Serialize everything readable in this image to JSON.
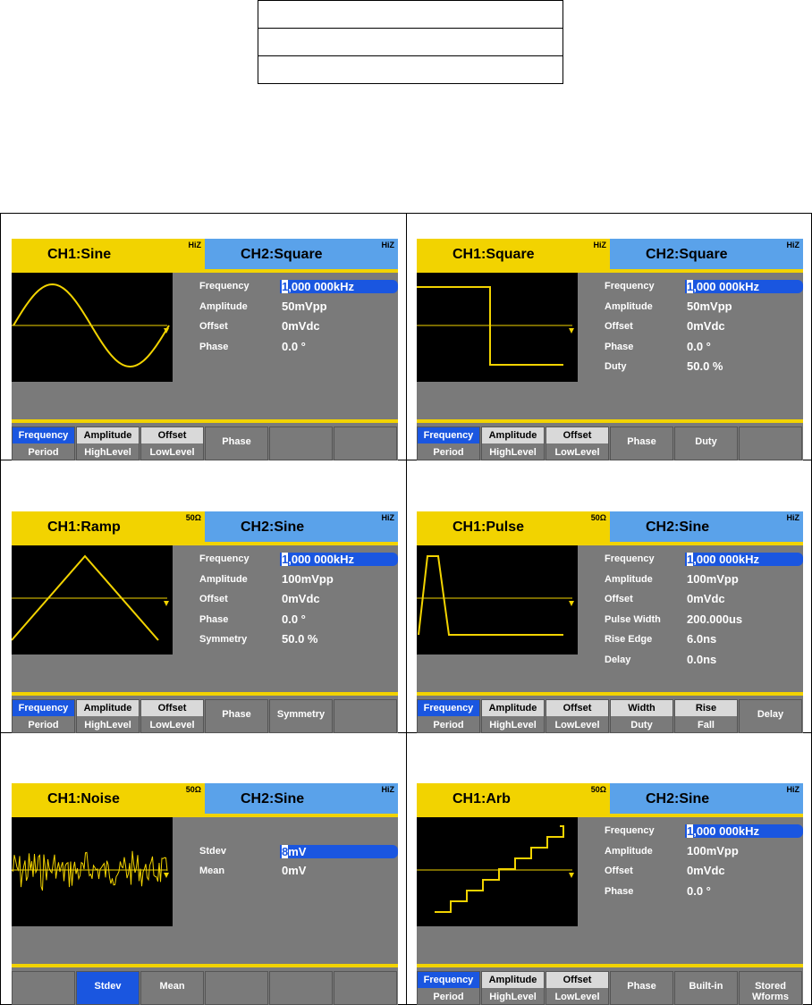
{
  "panels": [
    {
      "ch1": {
        "name": "CH1:Sine",
        "imp": "HiZ"
      },
      "ch2": {
        "name": "CH2:Square",
        "imp": "HiZ"
      },
      "wave": "sine",
      "params": [
        {
          "label": "Frequency",
          "value": "1,000 000kHz",
          "selected": true
        },
        {
          "label": "Amplitude",
          "value": "50mVpp"
        },
        {
          "label": "Offset",
          "value": "0mVdc"
        },
        {
          "label": "Phase",
          "value": "0.0 °"
        }
      ],
      "keys": [
        {
          "top": "Frequency",
          "bottom": "Period",
          "top_active": true
        },
        {
          "top": "Amplitude",
          "bottom": "HighLevel"
        },
        {
          "top": "Offset",
          "bottom": "LowLevel"
        },
        {
          "single": "Phase"
        },
        {
          "single": ""
        },
        {
          "single": ""
        }
      ]
    },
    {
      "ch1": {
        "name": "CH1:Square",
        "imp": "HiZ"
      },
      "ch2": {
        "name": "CH2:Square",
        "imp": "HiZ"
      },
      "wave": "square",
      "params": [
        {
          "label": "Frequency",
          "value": "1,000 000kHz",
          "selected": true
        },
        {
          "label": "Amplitude",
          "value": "50mVpp"
        },
        {
          "label": "Offset",
          "value": "0mVdc"
        },
        {
          "label": "Phase",
          "value": "0.0 °"
        },
        {
          "label": "Duty",
          "value": "50.0 %"
        }
      ],
      "keys": [
        {
          "top": "Frequency",
          "bottom": "Period",
          "top_active": true
        },
        {
          "top": "Amplitude",
          "bottom": "HighLevel"
        },
        {
          "top": "Offset",
          "bottom": "LowLevel"
        },
        {
          "single": "Phase"
        },
        {
          "single": "Duty"
        },
        {
          "single": ""
        }
      ]
    },
    {
      "ch1": {
        "name": "CH1:Ramp",
        "imp": "50Ω"
      },
      "ch2": {
        "name": "CH2:Sine",
        "imp": "HiZ"
      },
      "wave": "ramp",
      "params": [
        {
          "label": "Frequency",
          "value": "1,000 000kHz",
          "selected": true
        },
        {
          "label": "Amplitude",
          "value": "100mVpp"
        },
        {
          "label": "Offset",
          "value": "0mVdc"
        },
        {
          "label": "Phase",
          "value": "0.0 °"
        },
        {
          "label": "Symmetry",
          "value": "50.0 %"
        }
      ],
      "keys": [
        {
          "top": "Frequency",
          "bottom": "Period",
          "top_active": true
        },
        {
          "top": "Amplitude",
          "bottom": "HighLevel"
        },
        {
          "top": "Offset",
          "bottom": "LowLevel"
        },
        {
          "single": "Phase"
        },
        {
          "single": "Symmetry"
        },
        {
          "single": ""
        }
      ]
    },
    {
      "ch1": {
        "name": "CH1:Pulse",
        "imp": "50Ω"
      },
      "ch2": {
        "name": "CH2:Sine",
        "imp": "HiZ"
      },
      "wave": "pulse",
      "params": [
        {
          "label": "Frequency",
          "value": "1,000 000kHz",
          "selected": true
        },
        {
          "label": "Amplitude",
          "value": "100mVpp"
        },
        {
          "label": "Offset",
          "value": "0mVdc"
        },
        {
          "label": "Pulse Width",
          "value": "200.000us"
        },
        {
          "label": "Rise Edge",
          "value": "6.0ns"
        },
        {
          "label": "Delay",
          "value": "0.0ns"
        }
      ],
      "keys": [
        {
          "top": "Frequency",
          "bottom": "Period",
          "top_active": true
        },
        {
          "top": "Amplitude",
          "bottom": "HighLevel"
        },
        {
          "top": "Offset",
          "bottom": "LowLevel"
        },
        {
          "top": "Width",
          "bottom": "Duty"
        },
        {
          "top": "Rise",
          "bottom": "Fall"
        },
        {
          "single": "Delay"
        }
      ]
    },
    {
      "ch1": {
        "name": "CH1:Noise",
        "imp": "50Ω"
      },
      "ch2": {
        "name": "CH2:Sine",
        "imp": "HiZ"
      },
      "wave": "noise",
      "params": [
        {
          "label": "",
          "value": ""
        },
        {
          "label": "Stdev",
          "value": "8mV",
          "selected": true
        },
        {
          "label": "Mean",
          "value": "0mV"
        }
      ],
      "keys": [
        {
          "single": ""
        },
        {
          "single": "Stdev",
          "active": true
        },
        {
          "single": "Mean"
        },
        {
          "single": ""
        },
        {
          "single": ""
        },
        {
          "single": ""
        }
      ]
    },
    {
      "ch1": {
        "name": "CH1:Arb",
        "imp": "50Ω"
      },
      "ch2": {
        "name": "CH2:Sine",
        "imp": "HiZ"
      },
      "wave": "arb",
      "params": [
        {
          "label": "Frequency",
          "value": "1,000 000kHz",
          "selected": true
        },
        {
          "label": "Amplitude",
          "value": "100mVpp"
        },
        {
          "label": "Offset",
          "value": "0mVdc"
        },
        {
          "label": "Phase",
          "value": "0.0 °"
        }
      ],
      "keys": [
        {
          "top": "Frequency",
          "bottom": "Period",
          "top_active": true
        },
        {
          "top": "Amplitude",
          "bottom": "HighLevel"
        },
        {
          "top": "Offset",
          "bottom": "LowLevel"
        },
        {
          "single": "Phase"
        },
        {
          "single": "Built-in"
        },
        {
          "single": "Stored Wforms"
        }
      ]
    }
  ]
}
